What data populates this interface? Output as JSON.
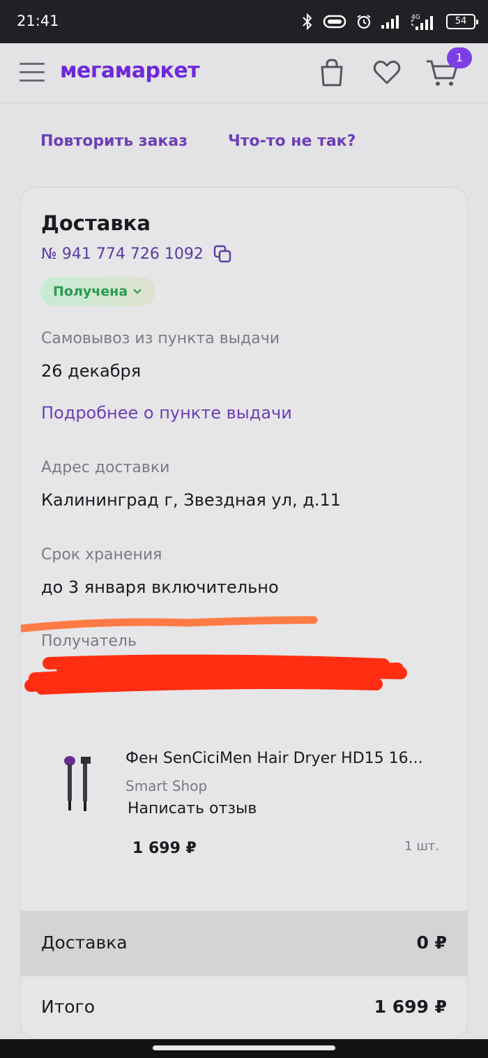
{
  "status_bar": {
    "time": "21:41",
    "battery": "54",
    "network": "4G"
  },
  "app": {
    "logo": "мегамаркет",
    "cart_count": "1"
  },
  "actions": {
    "repeat_order": "Повторить заказ",
    "problem": "Что-то не так?"
  },
  "order": {
    "title": "Доставка",
    "number": "№ 941 774 726 1092",
    "status": "Получена",
    "pickup_label": "Самовывоз из пункта выдачи",
    "pickup_date": "26 декабря",
    "pickup_link": "Подробнее о пункте выдачи",
    "address_label": "Адрес доставки",
    "address_value": "Калининград г, Звездная ул, д.11",
    "storage_label": "Срок хранения",
    "storage_value": "до 3 января включительно",
    "recipient_label": "Получатель"
  },
  "product": {
    "title": "Фен SenCiciMen Hair Dryer HD15 16...",
    "shop": "Smart Shop",
    "review": "Написать отзыв",
    "price": "1 699 ₽",
    "qty": "1 шт."
  },
  "summary": {
    "delivery_label": "Доставка",
    "delivery_value": "0 ₽",
    "total_label": "Итого",
    "total_value": "1 699 ₽"
  },
  "colors": {
    "brand": "#6d28d9",
    "link": "#6d3fb5",
    "status_green": "#2a9b51",
    "badge": "#7b3fe4"
  }
}
